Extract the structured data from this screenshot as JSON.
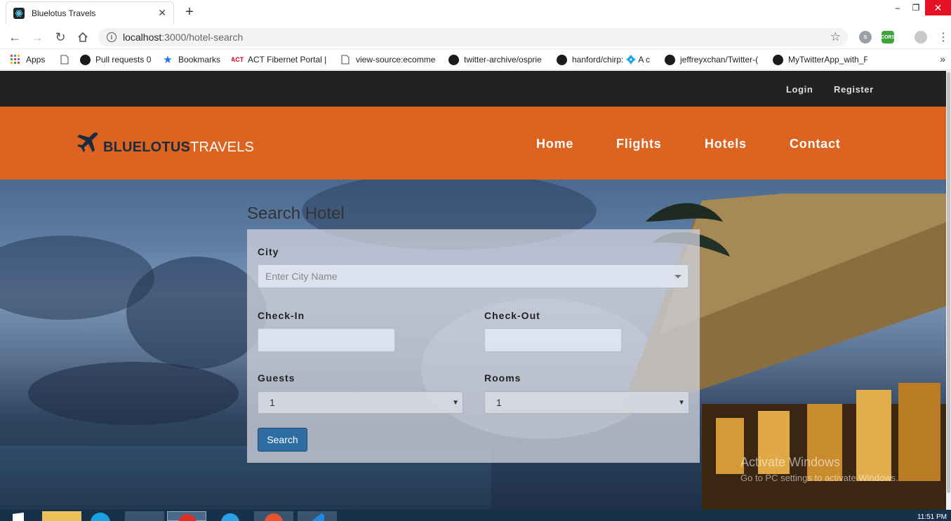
{
  "browser": {
    "tab_title": "Bluelotus Travels",
    "tab_close": "✕",
    "new_tab": "+",
    "url_host": "localhost",
    "url_path": ":3000/hotel-search",
    "bookmarks": [
      {
        "label": "Apps",
        "icon": "apps-grid-icon"
      },
      {
        "label": "Pull requests 0",
        "icon": "github-icon"
      },
      {
        "label": "Bookmarks",
        "icon": "star-icon"
      },
      {
        "label": "ACT Fibernet Portal |",
        "icon": "act-icon"
      },
      {
        "label": "view-source:ecomme",
        "icon": "page-icon"
      },
      {
        "label": "twitter-archive/osprie",
        "icon": "github-icon"
      },
      {
        "label": "hanford/chirp: 💠 A c",
        "icon": "github-icon"
      },
      {
        "label": "jeffreyxchan/Twitter-(",
        "icon": "github-icon"
      },
      {
        "label": "MyTwitterApp_with_F",
        "icon": "github-icon"
      }
    ]
  },
  "topbar": {
    "login": "Login",
    "register": "Register"
  },
  "brand": {
    "part1": "BLUELOTUS",
    "part2": "TRAVELS"
  },
  "nav": {
    "home": "Home",
    "flights": "Flights",
    "hotels": "Hotels",
    "contact": "Contact"
  },
  "search": {
    "title": "Search Hotel",
    "city_label": "City",
    "city_placeholder": "Enter City Name",
    "checkin_label": "Check-In",
    "checkout_label": "Check-Out",
    "guests_label": "Guests",
    "guests_value": "1",
    "rooms_label": "Rooms",
    "rooms_value": "1",
    "button": "Search"
  },
  "watermark": {
    "line1": "Activate Windows",
    "line2": "Go to PC settings to activate Windows."
  },
  "taskbar": {
    "clock": "11:51 PM"
  },
  "colors": {
    "topbar": "#222222",
    "header": "#dc6420",
    "brand_dark": "#1a2c3d",
    "button": "#2e6da4"
  }
}
